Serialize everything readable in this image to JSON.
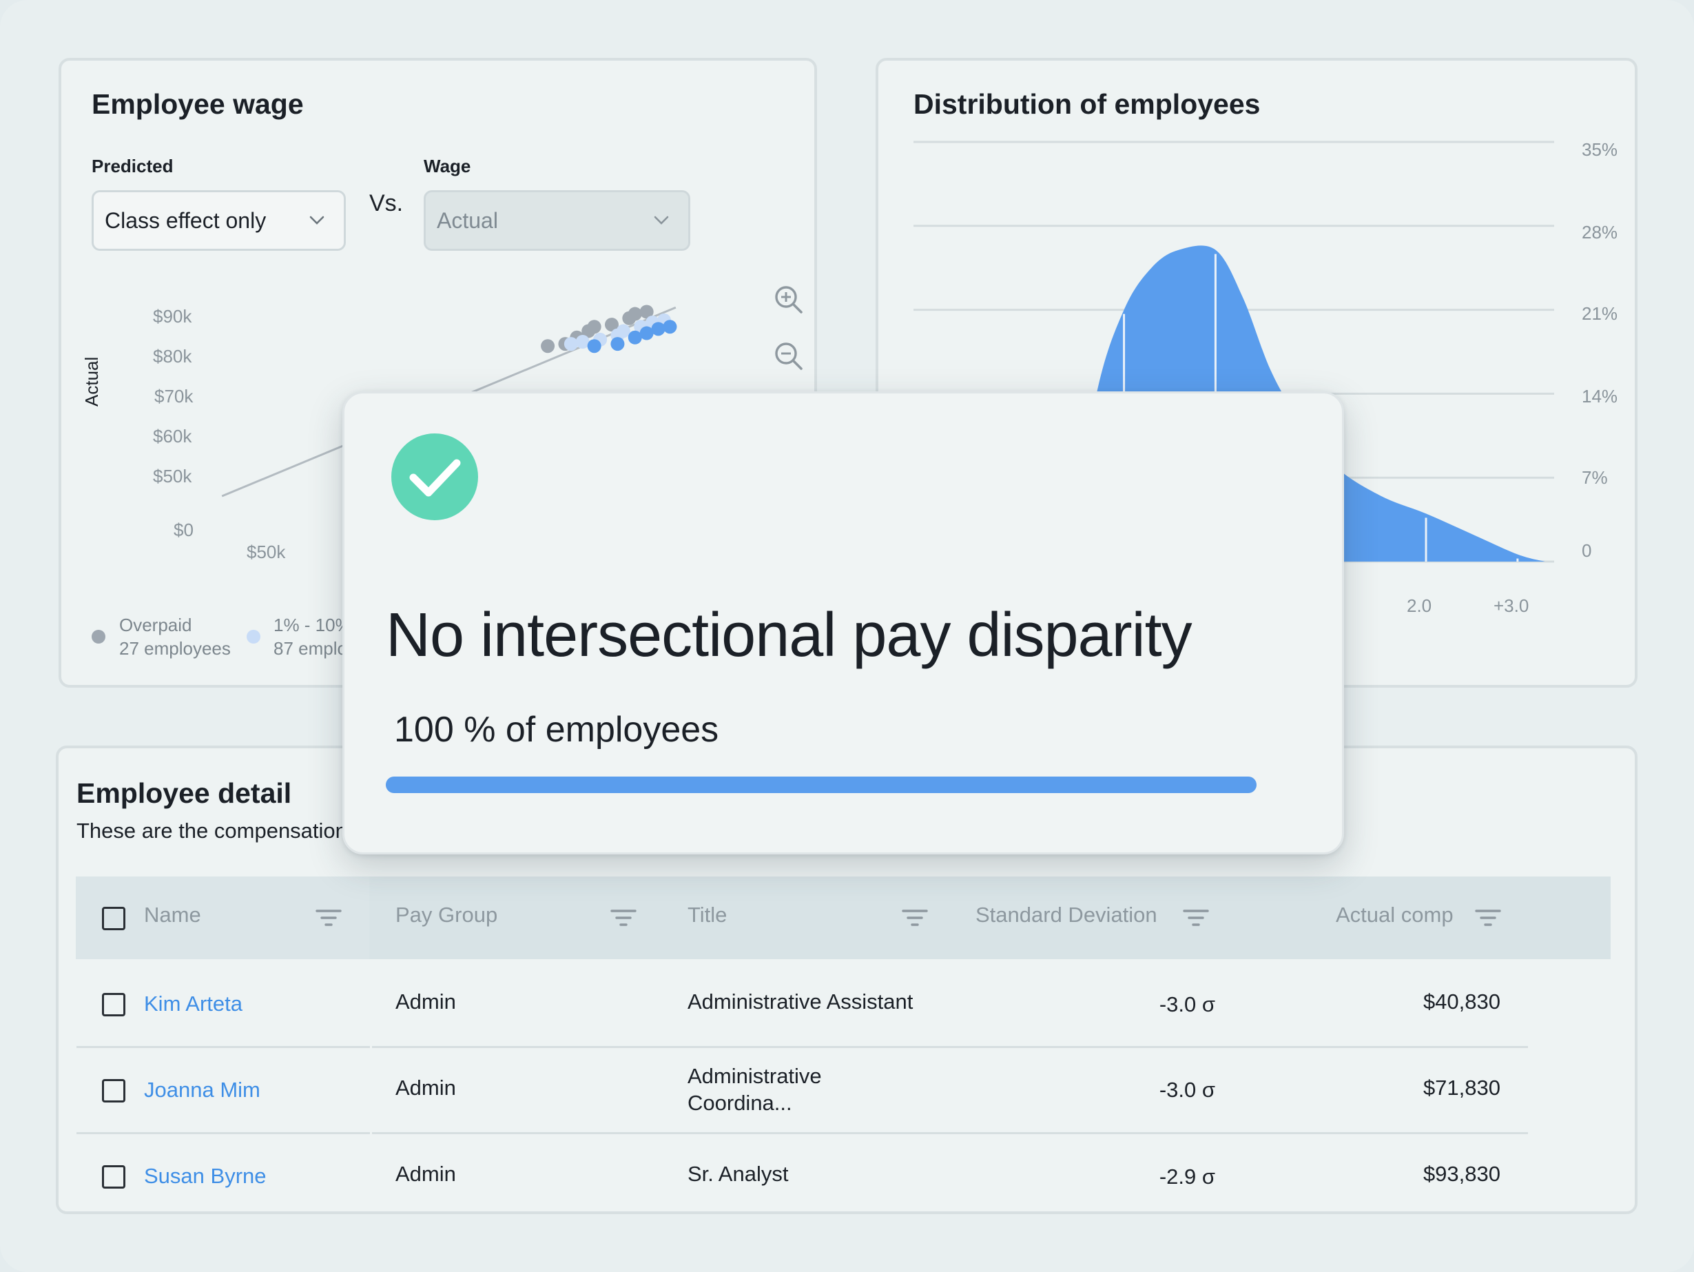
{
  "colors": {
    "accent": "#5a9ded",
    "link": "#3e8ee6",
    "success": "#5fd6b6",
    "overpaid_dot": "#9ea7b0",
    "light_dot": "#c8dcf7"
  },
  "wage_card": {
    "title": "Employee wage",
    "predicted_label": "Predicted",
    "predicted_value": "Class effect only",
    "vs_label": "Vs.",
    "wage_label": "Wage",
    "wage_value": "Actual",
    "y_axis_label": "Actual",
    "zoom_in_icon": "zoom-in-icon",
    "zoom_out_icon": "zoom-out-icon",
    "legend": [
      {
        "label": "Overpaid",
        "count": "27 employees"
      },
      {
        "label": "1% - 10%",
        "count": "87 emplo"
      }
    ]
  },
  "distribution_card": {
    "title": "Distribution of employees"
  },
  "chart_data": [
    {
      "type": "scatter",
      "title": "Employee wage",
      "xlabel": "",
      "ylabel": "Actual",
      "y_ticks": [
        "$90k",
        "$80k",
        "$70k",
        "$60k",
        "$50k",
        "$0"
      ],
      "x_ticks": [
        "$50k"
      ],
      "ylim": [
        0,
        90000
      ],
      "series": [
        {
          "name": "Overpaid",
          "points": [
            [
              76000,
              70000
            ],
            [
              79000,
              71000
            ],
            [
              81000,
              74000
            ],
            [
              83000,
              77000
            ],
            [
              84000,
              79000
            ],
            [
              87000,
              80000
            ],
            [
              90000,
              83000
            ],
            [
              91000,
              85000
            ],
            [
              93000,
              86000
            ]
          ]
        },
        {
          "name": "1% - 10%",
          "points": [
            [
              80000,
              71000
            ],
            [
              82000,
              72000
            ],
            [
              85000,
              73000
            ],
            [
              88000,
              75000
            ],
            [
              89000,
              77000
            ],
            [
              92000,
              79000
            ],
            [
              94000,
              81000
            ],
            [
              96000,
              82000
            ]
          ]
        },
        {
          "points": [
            [
              84000,
              70000
            ],
            [
              88000,
              71000
            ],
            [
              91000,
              74000
            ],
            [
              93000,
              76000
            ],
            [
              95000,
              78000
            ],
            [
              97000,
              79000
            ]
          ]
        }
      ],
      "trend_line": [
        [
          20000,
          0
        ],
        [
          98000,
          88000
        ]
      ]
    },
    {
      "type": "area",
      "title": "Distribution of employees",
      "y_ticks": [
        "35%",
        "28%",
        "21%",
        "14%",
        "7%",
        "0"
      ],
      "ylim": [
        0,
        35
      ],
      "x_ticks": [
        "2.0",
        "+3.0"
      ],
      "xlim": [
        -3.6,
        3.4
      ],
      "x": [
        -1.9,
        -1.6,
        -1.3,
        -1.0,
        -0.7,
        -0.3,
        0.0,
        0.3,
        0.6,
        1.0,
        1.5,
        2.0,
        2.5,
        3.0,
        3.3
      ],
      "values": [
        0,
        14,
        21,
        24.5,
        26,
        26,
        22,
        16,
        12,
        8,
        5.5,
        4,
        2.3,
        0.6,
        0
      ],
      "markers_x": [
        -1.3,
        -0.3,
        2.0,
        3.0
      ]
    }
  ],
  "modal": {
    "icon": "check-circle-icon",
    "title": "No intersectional pay disparity",
    "subtitle": "100 % of employees",
    "progress": 1.0
  },
  "detail_card": {
    "title": "Employee detail",
    "subtitle": "These are the compensation"
  },
  "table": {
    "columns": [
      "Name",
      "Pay Group",
      "Title",
      "Standard Deviation",
      "Actual comp"
    ],
    "rows": [
      {
        "name": "Kim Arteta",
        "pay_group": "Admin",
        "title": "Administrative Assistant",
        "title2": "",
        "sd": "-3.0 σ",
        "comp": "$40,830"
      },
      {
        "name": "Joanna Mim",
        "pay_group": "Admin",
        "title": "Administrative",
        "title2": "Coordina...",
        "sd": "-3.0 σ",
        "comp": "$71,830"
      },
      {
        "name": "Susan Byrne",
        "pay_group": "Admin",
        "title": "Sr. Analyst",
        "title2": "",
        "sd": "-2.9 σ",
        "comp": "$93,830"
      }
    ]
  }
}
